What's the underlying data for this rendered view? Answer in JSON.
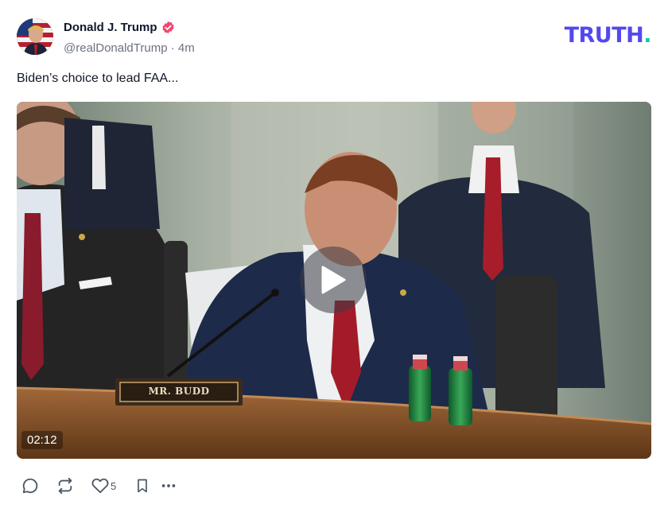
{
  "post": {
    "author_name": "Donald J. Trump",
    "handle": "@realDonaldTrump",
    "separator": "·",
    "time_ago": "4m",
    "text": "Biden’s choice to lead FAA...",
    "video": {
      "duration": "02:12",
      "nameplate": "MR. BUDD"
    },
    "actions": {
      "like_count": "5"
    }
  },
  "brand": {
    "logo_text": "TRUTH",
    "logo_dot": ".",
    "logo_color": "#5448ee",
    "dot_color": "#14c8a8"
  },
  "icons": {
    "verified": "verified-badge-icon",
    "reply": "reply-icon",
    "repost": "repost-icon",
    "like": "heart-icon",
    "bookmark": "bookmark-icon",
    "more": "more-icon",
    "play": "play-icon"
  },
  "colors": {
    "verified_badge": "#f04770",
    "text_primary": "#111827",
    "text_secondary": "#6b7280"
  }
}
